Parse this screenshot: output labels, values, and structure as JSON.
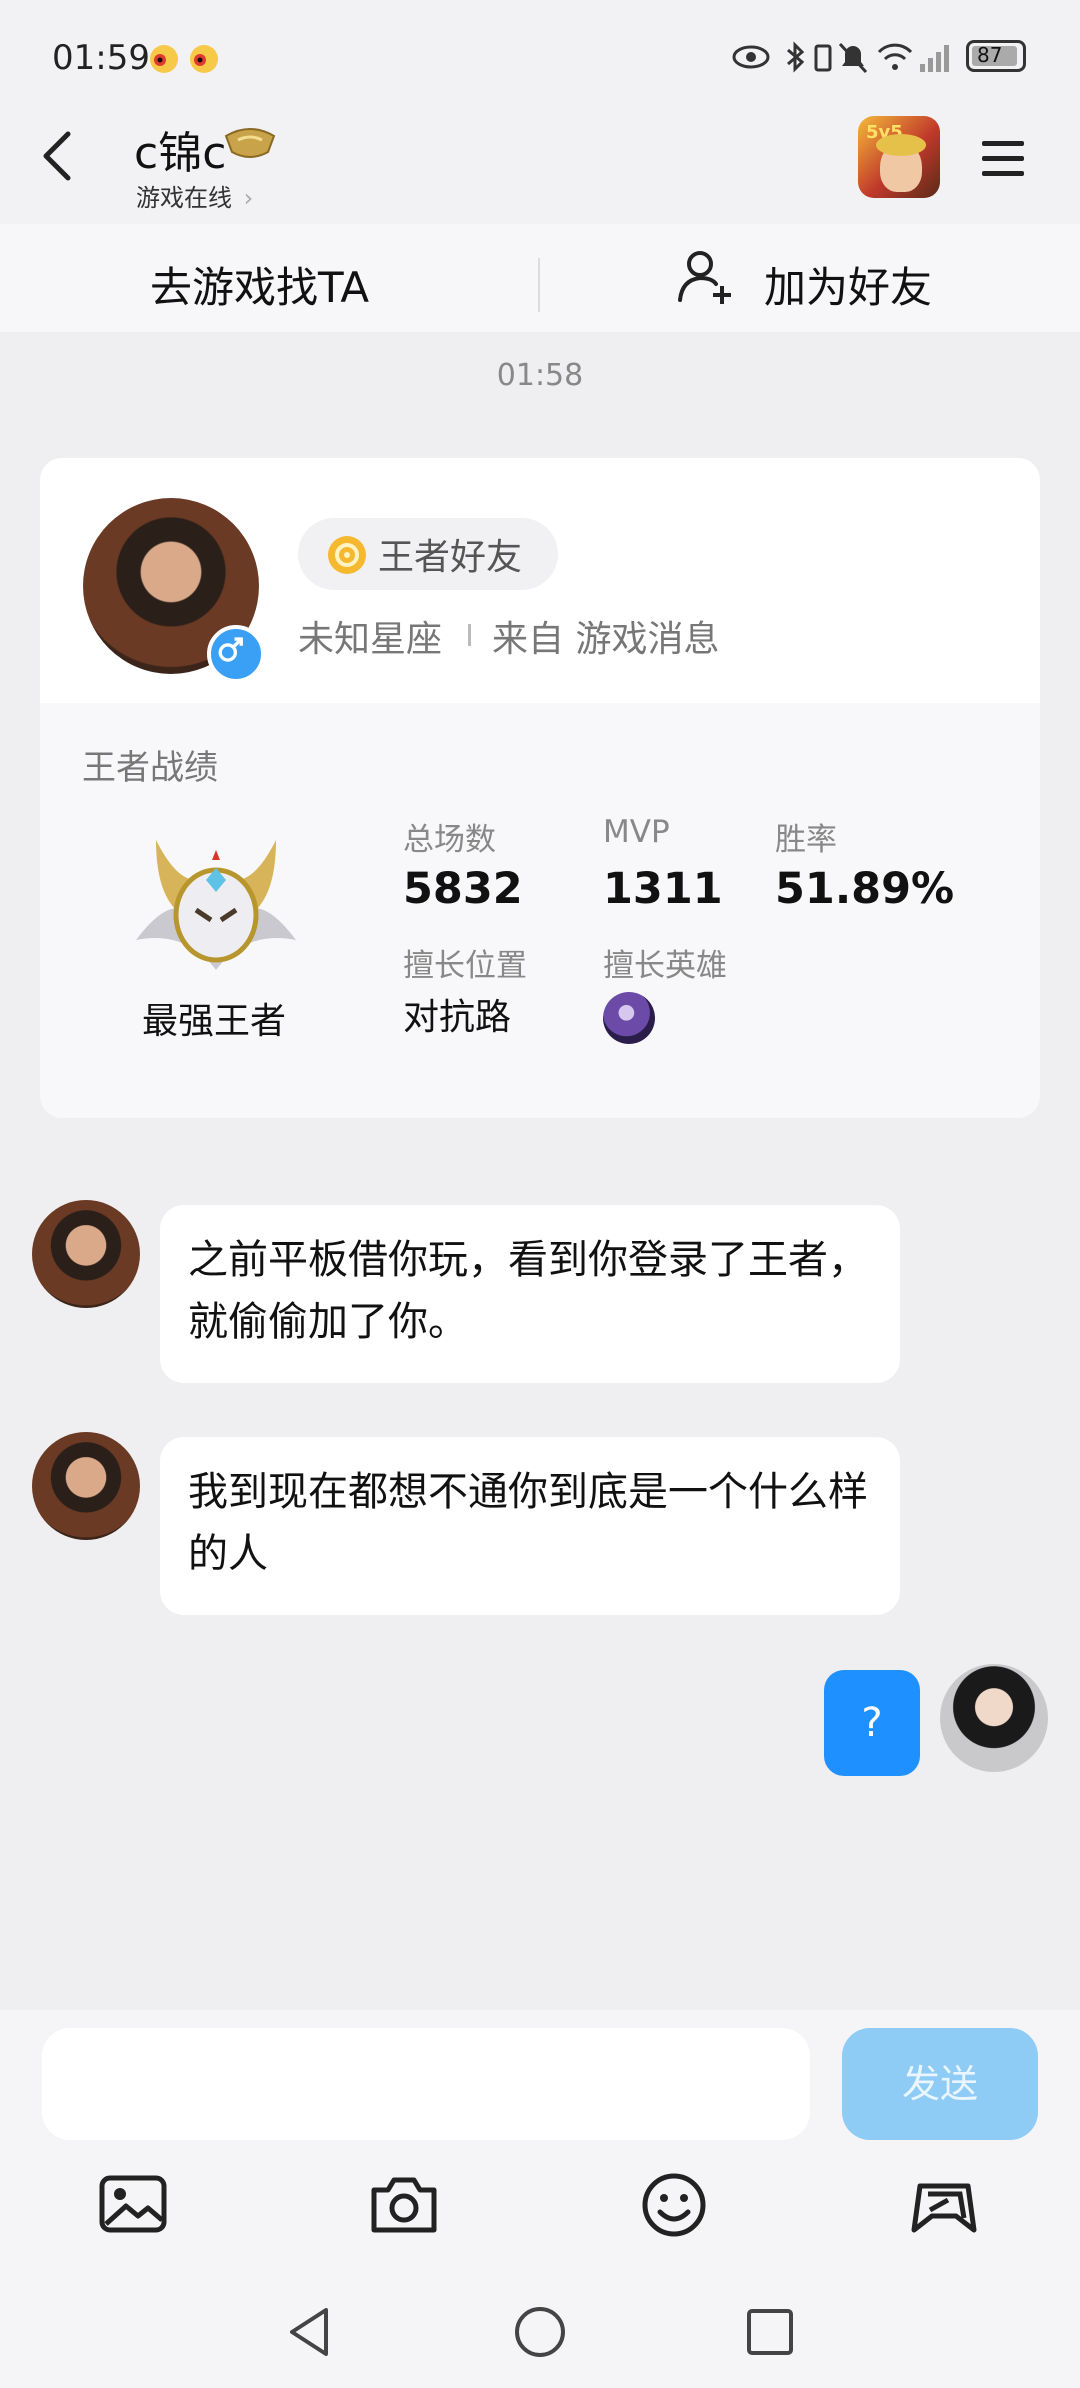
{
  "status_bar": {
    "time": "01:59",
    "battery": "87"
  },
  "header": {
    "title": "c锦c",
    "subtitle": "游戏在线",
    "subtitle_chevron": "›"
  },
  "actions": {
    "find_in_game": "去游戏找TA",
    "add_friend": "加为好友"
  },
  "timestamp": "01:58",
  "profile": {
    "friend_tag": "王者好友",
    "zodiac": "未知星座",
    "source": "来自 游戏消息",
    "section_title": "王者战绩",
    "rank_name": "最强王者",
    "stats": [
      {
        "label": "总场数",
        "value": "5832"
      },
      {
        "label": "MVP",
        "value": "1311"
      },
      {
        "label": "胜率",
        "value": "51.89%"
      }
    ],
    "position_label": "擅长位置",
    "position_value": "对抗路",
    "hero_label": "擅长英雄"
  },
  "messages": [
    {
      "from": "other",
      "text": "之前平板借你玩，看到你登录了王者，就偷偷加了你。"
    },
    {
      "from": "other",
      "text": "我到现在都想不通你到底是一个什么样的人"
    },
    {
      "from": "me",
      "text": "?"
    }
  ],
  "composer": {
    "placeholder": "",
    "send_label": "发送"
  },
  "toolbar_icons": [
    "image-icon",
    "camera-icon",
    "emoji-icon",
    "gamepad-icon"
  ],
  "nav_icons": [
    "back-triangle-icon",
    "home-circle-icon",
    "recents-square-icon"
  ],
  "colors": {
    "accent": "#1e90ff",
    "send_disabled": "#8ecbf5",
    "male_badge": "#3aa0f5"
  }
}
